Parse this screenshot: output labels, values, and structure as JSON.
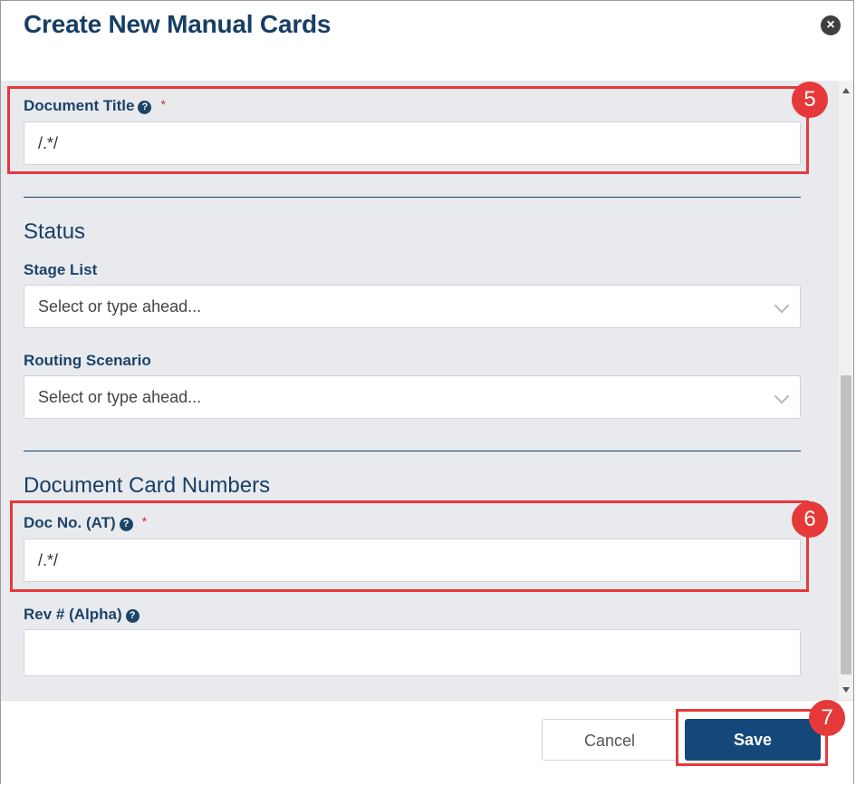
{
  "dialog": {
    "title": "Create New Manual Cards",
    "close_icon": "×"
  },
  "fields": {
    "document_title": {
      "label": "Document Title",
      "required_mark": "*",
      "help_icon": "?",
      "value": "/.*/"
    },
    "doc_no": {
      "label": "Doc No. (AT)",
      "required_mark": "*",
      "help_icon": "?",
      "value": "/.*/"
    },
    "rev": {
      "label": "Rev # (Alpha)",
      "help_icon": "?",
      "value": ""
    }
  },
  "status": {
    "heading": "Status",
    "stage_list": {
      "label": "Stage List",
      "placeholder": "Select or type ahead..."
    },
    "routing_scenario": {
      "label": "Routing Scenario",
      "placeholder": "Select or type ahead..."
    }
  },
  "doc_card_numbers": {
    "heading": "Document Card Numbers"
  },
  "footer": {
    "cancel_label": "Cancel",
    "save_label": "Save"
  },
  "annotations": {
    "badge_5": "5",
    "badge_6": "6",
    "badge_7": "7"
  },
  "colors": {
    "primary": "#15487a",
    "heading": "#173f66",
    "highlight": "#e5393a",
    "required": "#d9231f",
    "body_bg": "#e9eaee"
  }
}
